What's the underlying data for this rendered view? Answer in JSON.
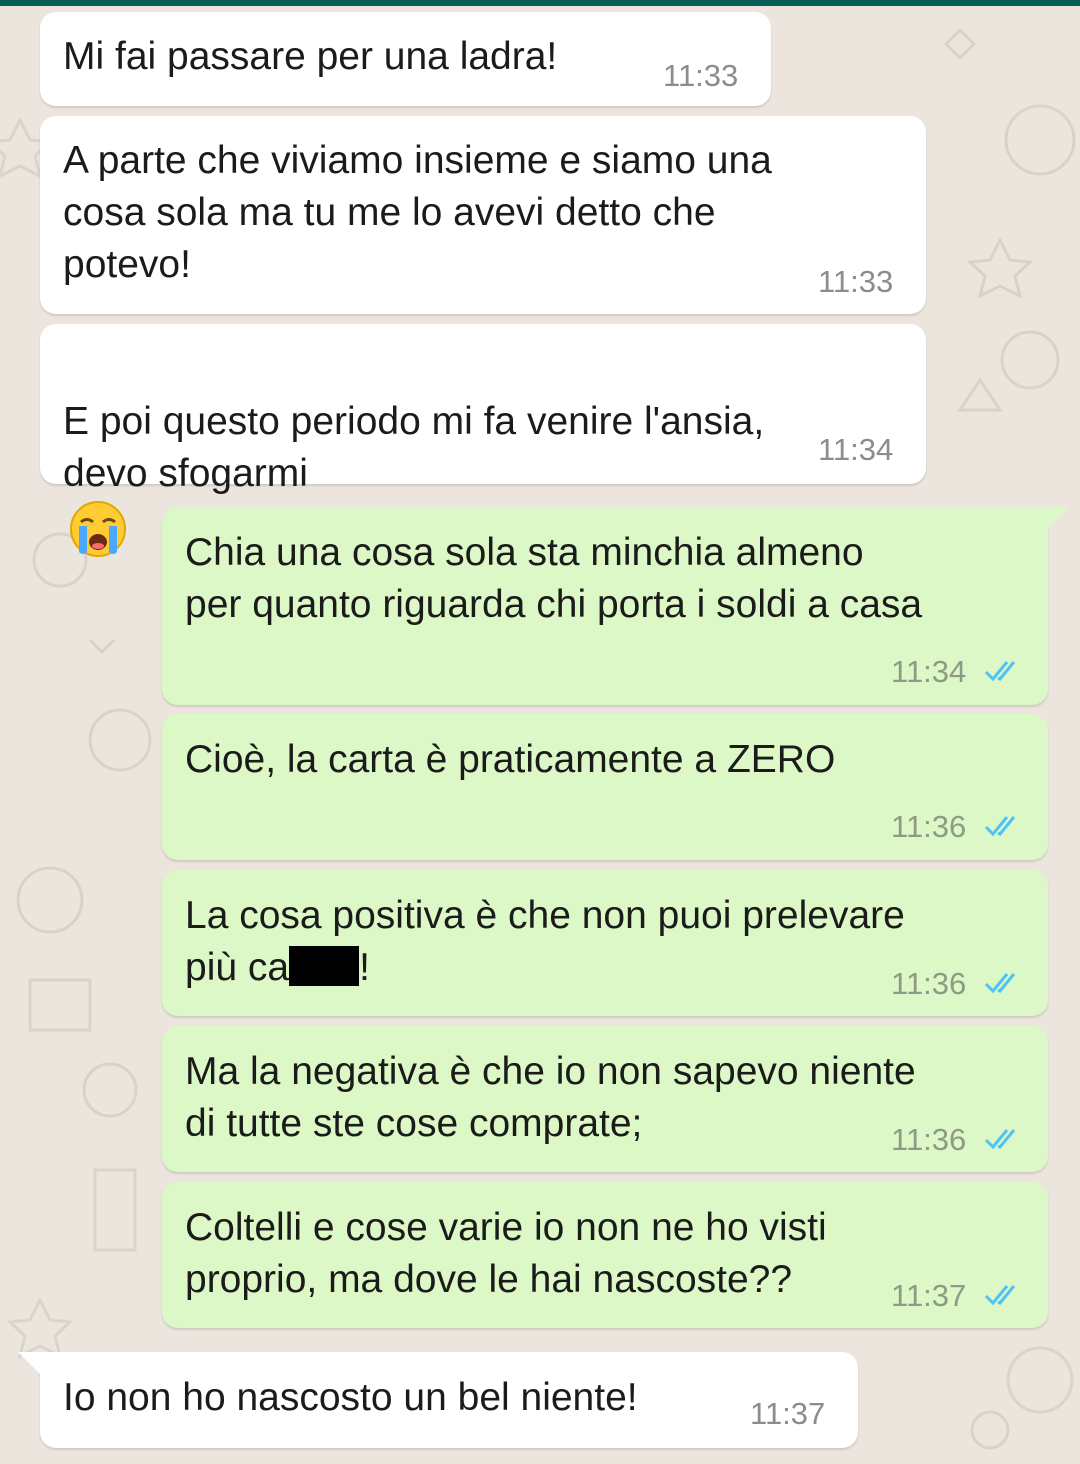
{
  "messages": [
    {
      "id": "m1",
      "direction": "in",
      "text": "Mi fai passare per una ladra!",
      "time": "11:33"
    },
    {
      "id": "m2",
      "direction": "in",
      "text": "A parte che viviamo insieme e siamo una\ncosa sola ma tu me lo avevi detto che\npotevo!",
      "time": "11:33"
    },
    {
      "id": "m3",
      "direction": "in",
      "text": "E poi questo periodo mi fa venire l'ansia,\ndevo sfogarmi",
      "emoji": "loudly-crying-face",
      "time": "11:34"
    },
    {
      "id": "m4",
      "direction": "out",
      "text": "Chia una cosa sola sta minchia almeno\nper quanto riguarda chi porta i soldi a casa",
      "time": "11:34",
      "status": "read"
    },
    {
      "id": "m5",
      "direction": "out",
      "text": "Cioè, la carta è praticamente a ZERO",
      "time": "11:36",
      "status": "read"
    },
    {
      "id": "m6",
      "direction": "out",
      "text_line1": "La cosa positiva è che non puoi prelevare",
      "text_line2_before": "più ca",
      "text_line2_after": "!",
      "redacted": true,
      "time": "11:36",
      "status": "read"
    },
    {
      "id": "m7",
      "direction": "out",
      "text": "Ma la negativa è che io non sapevo niente\ndi tutte ste cose comprate;",
      "time": "11:36",
      "status": "read"
    },
    {
      "id": "m8",
      "direction": "out",
      "text": "Coltelli e cose varie io non ne ho visti\nproprio, ma dove le hai nascoste??",
      "time": "11:37",
      "status": "read"
    },
    {
      "id": "m9",
      "direction": "in",
      "text": "Io non ho nascosto un bel niente!",
      "time": "11:37"
    }
  ],
  "colors": {
    "background": "#ece5dd",
    "incoming_bubble": "#ffffff",
    "outgoing_bubble": "#dcf8c6",
    "read_ticks": "#4fc3f7",
    "header": "#075e54"
  }
}
